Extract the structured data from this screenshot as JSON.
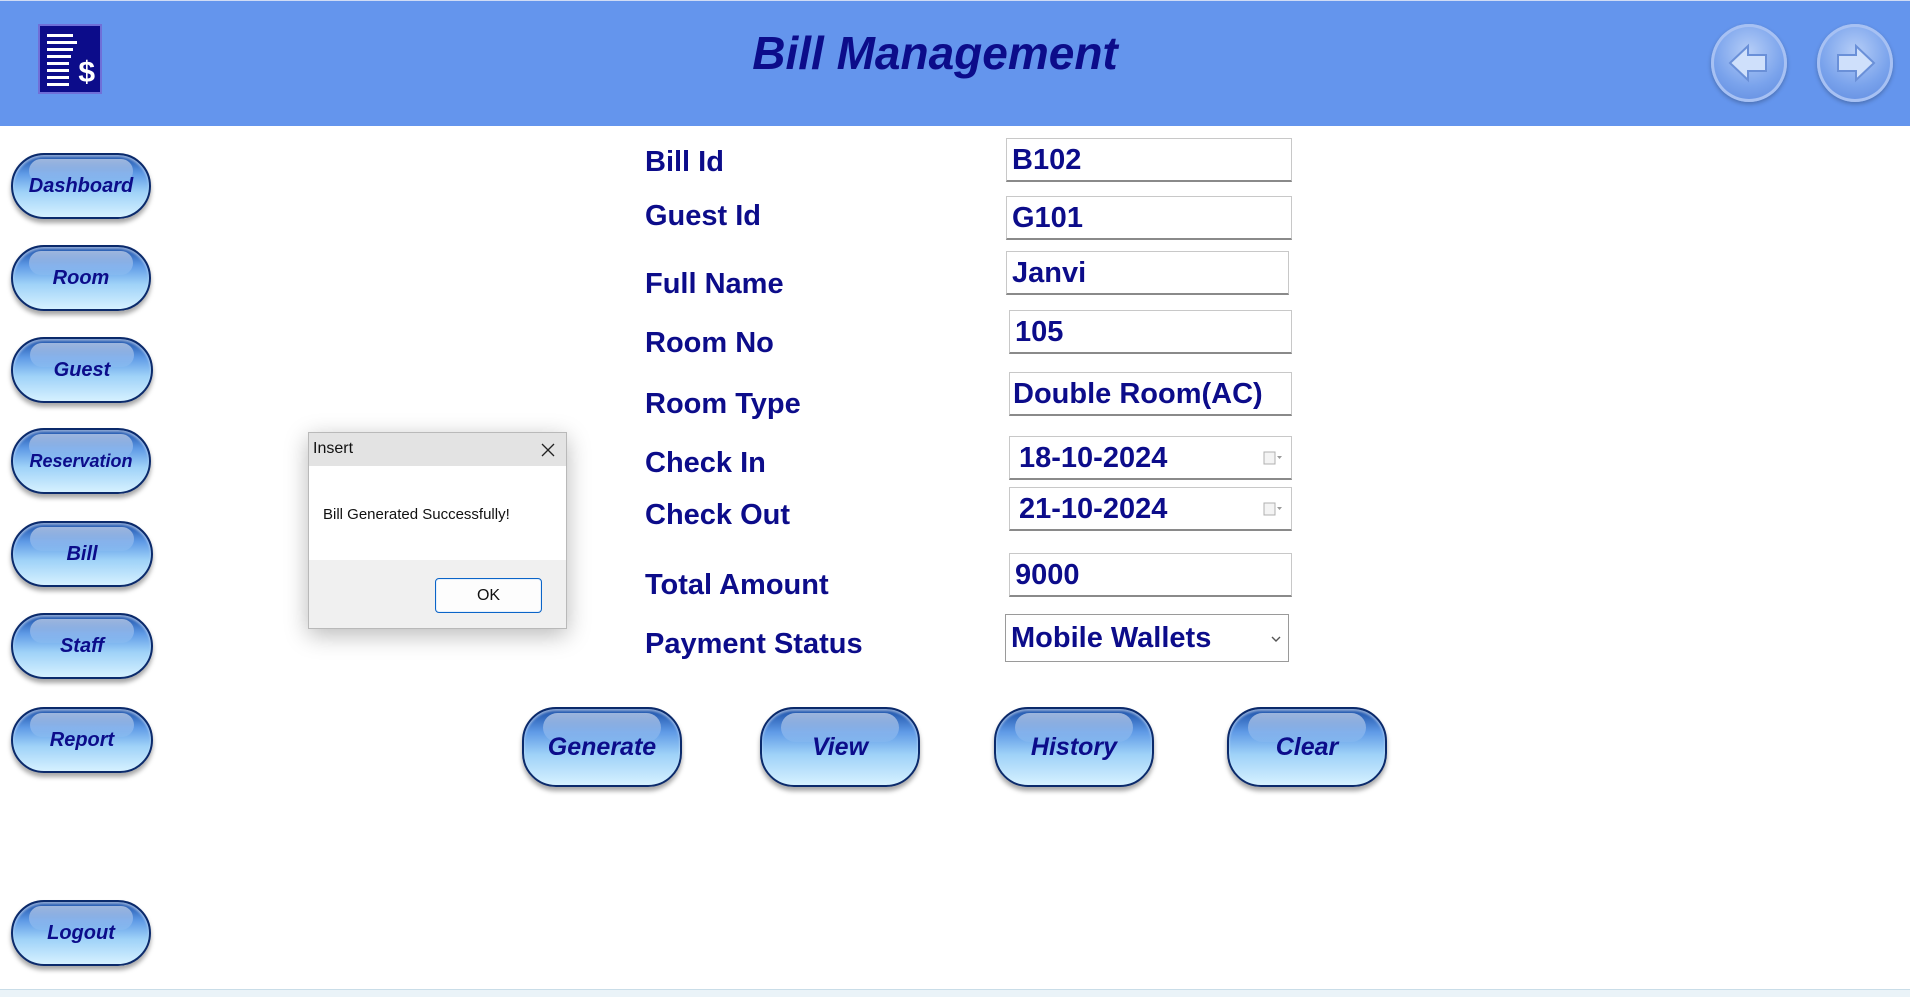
{
  "header": {
    "title": "Bill Management",
    "logo_icon": "bill-dollar-icon",
    "back_icon": "arrow-left-icon",
    "forward_icon": "arrow-right-icon",
    "background": "#6495ed",
    "title_color": "#0c0c8a"
  },
  "sidebar": {
    "items": [
      {
        "label": "Dashboard"
      },
      {
        "label": "Room"
      },
      {
        "label": "Guest"
      },
      {
        "label": "Reservation"
      },
      {
        "label": "Bill"
      },
      {
        "label": "Staff"
      },
      {
        "label": "Report"
      }
    ],
    "logout_label": "Logout"
  },
  "form": {
    "bill_id": {
      "label": "Bill Id",
      "value": "B102"
    },
    "guest_id": {
      "label": "Guest Id",
      "value": "G101"
    },
    "full_name": {
      "label": "Full Name",
      "value": "Janvi"
    },
    "room_no": {
      "label": "Room No",
      "value": "105"
    },
    "room_type": {
      "label": "Room Type",
      "value": "Double Room(AC)"
    },
    "check_in": {
      "label": "Check In",
      "value": "18-10-2024"
    },
    "check_out": {
      "label": "Check Out",
      "value": "21-10-2024"
    },
    "total_amount": {
      "label": "Total Amount",
      "value": "9000"
    },
    "payment_status": {
      "label": "Payment Status",
      "value": "Mobile Wallets"
    }
  },
  "actions": {
    "generate_label": "Generate",
    "view_label": "View",
    "history_label": "History",
    "clear_label": "Clear"
  },
  "dialog": {
    "title": "Insert",
    "message": "Bill Generated Successfully!",
    "ok_label": "OK"
  }
}
